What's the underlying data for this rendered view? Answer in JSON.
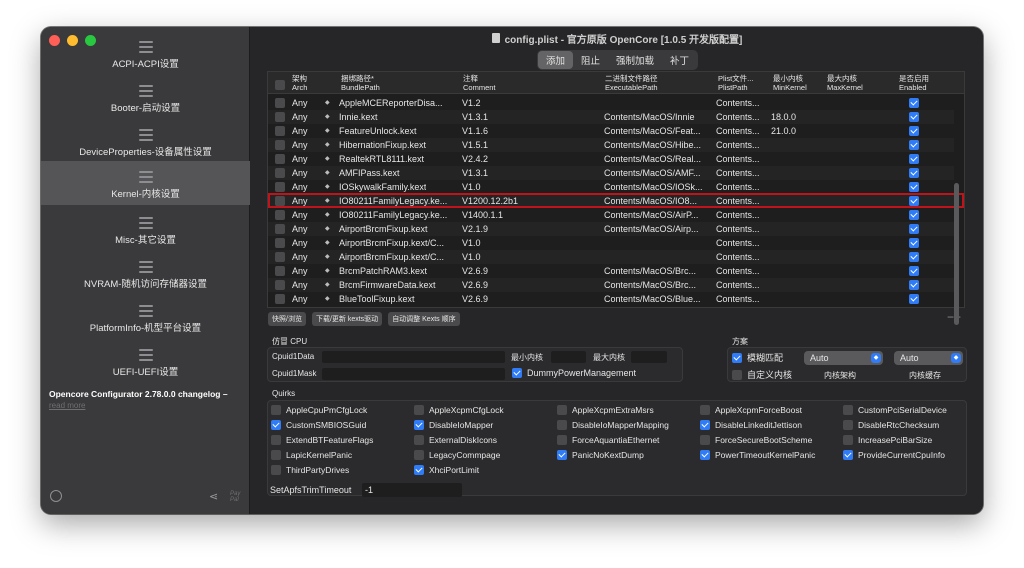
{
  "window": {
    "title": "config.plist - 官方原版 OpenCore [1.0.5 开发版配置]"
  },
  "sidebar": {
    "items": [
      {
        "label": "ACPI-ACPI设置"
      },
      {
        "label": "Booter-启动设置"
      },
      {
        "label": "DeviceProperties-设备属性设置"
      },
      {
        "label": "Kernel-内核设置"
      },
      {
        "label": "Misc-其它设置"
      },
      {
        "label": "NVRAM-随机访问存储器设置"
      },
      {
        "label": "PlatformInfo-机型平台设置"
      },
      {
        "label": "UEFI-UEFI设置"
      }
    ],
    "changelog_title": "Opencore Configurator 2.78.0.0 changelog –",
    "changelog_link": "read more",
    "pay_label": "Pay Pal"
  },
  "tabs": [
    "添加",
    "阻止",
    "强制加载",
    "补丁"
  ],
  "table": {
    "headers": {
      "arch": "架构",
      "arch_en": "Arch",
      "bundle": "捆绑路径*",
      "bundle_en": "BundlePath",
      "comment": "注释",
      "comment_en": "Comment",
      "exec": "二进制文件路径",
      "exec_en": "ExecutablePath",
      "plist": "Plist文件...",
      "plist_en": "PlistPath",
      "minkernel": "最小内核",
      "minkernel_en": "MinKernel",
      "maxkernel": "最大内核",
      "maxkernel_en": "MaxKernel",
      "enabled": "是否启用",
      "enabled_en": "Enabled"
    },
    "rows": [
      {
        "arch": "Any",
        "bundle": "AppleMCEReporterDisa...",
        "comment": "V1.2",
        "exec": "",
        "plist": "Contents...",
        "min": "",
        "max": ""
      },
      {
        "arch": "Any",
        "bundle": "Innie.kext",
        "comment": "V1.3.1",
        "exec": "Contents/MacOS/Innie",
        "plist": "Contents...",
        "min": "18.0.0",
        "max": ""
      },
      {
        "arch": "Any",
        "bundle": "FeatureUnlock.kext",
        "comment": "V1.1.6",
        "exec": "Contents/MacOS/Feat...",
        "plist": "Contents...",
        "min": "21.0.0",
        "max": ""
      },
      {
        "arch": "Any",
        "bundle": "HibernationFixup.kext",
        "comment": "V1.5.1",
        "exec": "Contents/MacOS/Hibe...",
        "plist": "Contents...",
        "min": "",
        "max": ""
      },
      {
        "arch": "Any",
        "bundle": "RealtekRTL8111.kext",
        "comment": "V2.4.2",
        "exec": "Contents/MacOS/Real...",
        "plist": "Contents...",
        "min": "",
        "max": ""
      },
      {
        "arch": "Any",
        "bundle": "AMFIPass.kext",
        "comment": "V1.3.1",
        "exec": "Contents/MacOS/AMF...",
        "plist": "Contents...",
        "min": "",
        "max": ""
      },
      {
        "arch": "Any",
        "bundle": "IOSkywalkFamily.kext",
        "comment": "V1.0",
        "exec": "Contents/MacOS/IOSk...",
        "plist": "Contents...",
        "min": "",
        "max": ""
      },
      {
        "arch": "Any",
        "bundle": "IO80211FamilyLegacy.ke...",
        "comment": "V1200.12.2b1",
        "exec": "Contents/MacOS/IO8...",
        "plist": "Contents...",
        "min": "",
        "max": ""
      },
      {
        "arch": "Any",
        "bundle": "IO80211FamilyLegacy.ke...",
        "comment": "V1400.1.1",
        "exec": "Contents/MacOS/AirP...",
        "plist": "Contents...",
        "min": "",
        "max": ""
      },
      {
        "arch": "Any",
        "bundle": "AirportBrcmFixup.kext",
        "comment": "V2.1.9",
        "exec": "Contents/MacOS/Airp...",
        "plist": "Contents...",
        "min": "",
        "max": ""
      },
      {
        "arch": "Any",
        "bundle": "AirportBrcmFixup.kext/C...",
        "comment": "V1.0",
        "exec": "",
        "plist": "Contents...",
        "min": "",
        "max": ""
      },
      {
        "arch": "Any",
        "bundle": "AirportBrcmFixup.kext/C...",
        "comment": "V1.0",
        "exec": "",
        "plist": "Contents...",
        "min": "",
        "max": ""
      },
      {
        "arch": "Any",
        "bundle": "BrcmPatchRAM3.kext",
        "comment": "V2.6.9",
        "exec": "Contents/MacOS/Brc...",
        "plist": "Contents...",
        "min": "",
        "max": ""
      },
      {
        "arch": "Any",
        "bundle": "BrcmFirmwareData.kext",
        "comment": "V2.6.9",
        "exec": "Contents/MacOS/Brc...",
        "plist": "Contents...",
        "min": "",
        "max": ""
      },
      {
        "arch": "Any",
        "bundle": "BlueToolFixup.kext",
        "comment": "V2.6.9",
        "exec": "Contents/MacOS/Blue...",
        "plist": "Contents...",
        "min": "",
        "max": ""
      }
    ]
  },
  "table_buttons": [
    "快照/浏览",
    "下载/更新 kexts驱动",
    "自动调整 Kexts 顺序"
  ],
  "emulate": {
    "title": "仿冒 CPU",
    "cpuid1data": "Cpuid1Data",
    "cpuid1mask": "Cpuid1Mask",
    "min_kernel": "最小内核",
    "max_kernel": "最大内核",
    "dummy": "DummyPowerManagement"
  },
  "scheme": {
    "title": "方案",
    "fuzzy": "模糊匹配",
    "custom": "自定义内核",
    "arch_value": "Auto",
    "arch_label": "内核架构",
    "cache_value": "Auto",
    "cache_label": "内核缓存"
  },
  "quirks": {
    "title": "Quirks",
    "items": [
      {
        "label": "AppleCpuPmCfgLock",
        "on": false
      },
      {
        "label": "AppleXcpmCfgLock",
        "on": false
      },
      {
        "label": "AppleXcpmExtraMsrs",
        "on": false
      },
      {
        "label": "AppleXcpmForceBoost",
        "on": false
      },
      {
        "label": "CustomPciSerialDevice",
        "on": false
      },
      {
        "label": "CustomSMBIOSGuid",
        "on": true
      },
      {
        "label": "DisableIoMapper",
        "on": true
      },
      {
        "label": "DisableIoMapperMapping",
        "on": false
      },
      {
        "label": "DisableLinkeditJettison",
        "on": true
      },
      {
        "label": "DisableRtcChecksum",
        "on": false
      },
      {
        "label": "ExtendBTFeatureFlags",
        "on": false
      },
      {
        "label": "ExternalDiskIcons",
        "on": false
      },
      {
        "label": "ForceAquantiaEthernet",
        "on": false
      },
      {
        "label": "ForceSecureBootScheme",
        "on": false
      },
      {
        "label": "IncreasePciBarSize",
        "on": false
      },
      {
        "label": "LapicKernelPanic",
        "on": false
      },
      {
        "label": "LegacyCommpage",
        "on": false
      },
      {
        "label": "PanicNoKextDump",
        "on": true
      },
      {
        "label": "PowerTimeoutKernelPanic",
        "on": true
      },
      {
        "label": "ProvideCurrentCpuInfo",
        "on": true
      },
      {
        "label": "ThirdPartyDrives",
        "on": false
      },
      {
        "label": "XhciPortLimit",
        "on": true
      }
    ],
    "trim_label": "SetApfsTrimTimeout",
    "trim_value": "-1"
  },
  "colors": {
    "accent": "#2f7cf6",
    "highlight": "#c0141c"
  }
}
